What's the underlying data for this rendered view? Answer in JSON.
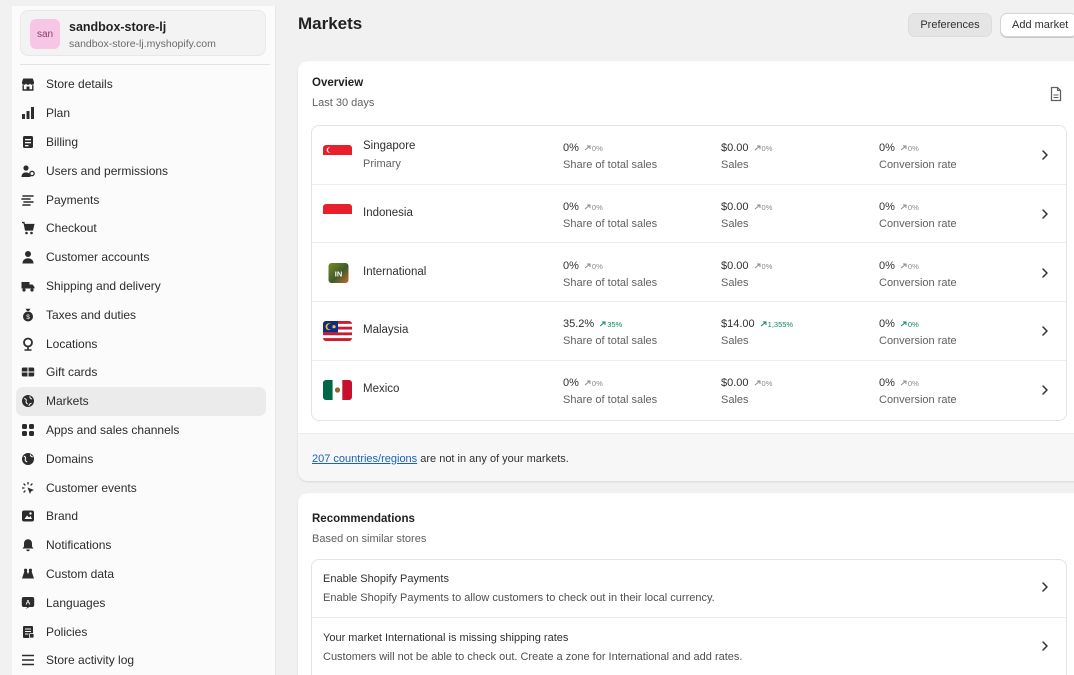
{
  "store": {
    "avatar": "san",
    "name": "sandbox-store-lj",
    "domain": "sandbox-store-lj.myshopify.com"
  },
  "sidebar": {
    "items": [
      {
        "label": "Store details",
        "icon": "store-icon"
      },
      {
        "label": "Plan",
        "icon": "plan-icon"
      },
      {
        "label": "Billing",
        "icon": "billing-icon"
      },
      {
        "label": "Users and permissions",
        "icon": "users-icon"
      },
      {
        "label": "Payments",
        "icon": "payments-icon"
      },
      {
        "label": "Checkout",
        "icon": "cart-icon"
      },
      {
        "label": "Customer accounts",
        "icon": "person-icon"
      },
      {
        "label": "Shipping and delivery",
        "icon": "truck-icon"
      },
      {
        "label": "Taxes and duties",
        "icon": "taxes-icon"
      },
      {
        "label": "Locations",
        "icon": "location-pin-icon"
      },
      {
        "label": "Gift cards",
        "icon": "gift-card-icon"
      },
      {
        "label": "Markets",
        "icon": "globe-icon",
        "active": true
      },
      {
        "label": "Apps and sales channels",
        "icon": "apps-icon"
      },
      {
        "label": "Domains",
        "icon": "domain-globe-icon"
      },
      {
        "label": "Customer events",
        "icon": "cursor-click-icon"
      },
      {
        "label": "Brand",
        "icon": "brand-icon"
      },
      {
        "label": "Notifications",
        "icon": "bell-icon"
      },
      {
        "label": "Custom data",
        "icon": "custom-data-icon"
      },
      {
        "label": "Languages",
        "icon": "languages-icon"
      },
      {
        "label": "Policies",
        "icon": "policies-icon"
      },
      {
        "label": "Store activity log",
        "icon": "activity-log-icon"
      }
    ]
  },
  "header": {
    "title": "Markets",
    "preferences_label": "Preferences",
    "add_market_label": "Add market"
  },
  "overview": {
    "title": "Overview",
    "subtitle": "Last 30 days",
    "export_icon": "document-icon",
    "markets": [
      {
        "name": "Singapore",
        "primary": "Primary",
        "flag": "singapore-flag",
        "share": "0%",
        "share_change": "0%",
        "sales": "$0.00",
        "sales_change": "0%",
        "conversion": "0%",
        "conversion_change": "0%"
      },
      {
        "name": "Indonesia",
        "primary": "",
        "flag": "indonesia-flag",
        "share": "0%",
        "share_change": "0%",
        "sales": "$0.00",
        "sales_change": "0%",
        "conversion": "0%",
        "conversion_change": "0%"
      },
      {
        "name": "International",
        "primary": "",
        "flag": "international-badge",
        "badge_text": "IN",
        "share": "0%",
        "share_change": "0%",
        "sales": "$0.00",
        "sales_change": "0%",
        "conversion": "0%",
        "conversion_change": "0%"
      },
      {
        "name": "Malaysia",
        "primary": "",
        "flag": "malaysia-flag",
        "share": "35.2%",
        "share_change": "35%",
        "sales": "$14.00",
        "sales_change": "1,355%",
        "conversion": "0%",
        "conversion_change": "0%",
        "positive": true
      },
      {
        "name": "Mexico",
        "primary": "",
        "flag": "mexico-flag",
        "share": "0%",
        "share_change": "0%",
        "sales": "$0.00",
        "sales_change": "0%",
        "conversion": "0%",
        "conversion_change": "0%"
      }
    ],
    "labels": {
      "share": "Share of total sales",
      "sales": "Sales",
      "conversion": "Conversion rate"
    },
    "footer": {
      "link": "207 countries/regions",
      "text": " are not in any of your markets."
    }
  },
  "recommendations": {
    "title": "Recommendations",
    "subtitle": "Based on similar stores",
    "items": [
      {
        "title": "Enable Shopify Payments",
        "desc": "Enable Shopify Payments to allow customers to check out in their local currency."
      },
      {
        "title": "Your market International is missing shipping rates",
        "desc": "Customers will not be able to check out. Create a zone for International and add rates."
      }
    ]
  },
  "colors": {
    "positive": "#0a8a5c",
    "link": "#1a5fc6",
    "avatar_bg": "#f7c6e6"
  }
}
